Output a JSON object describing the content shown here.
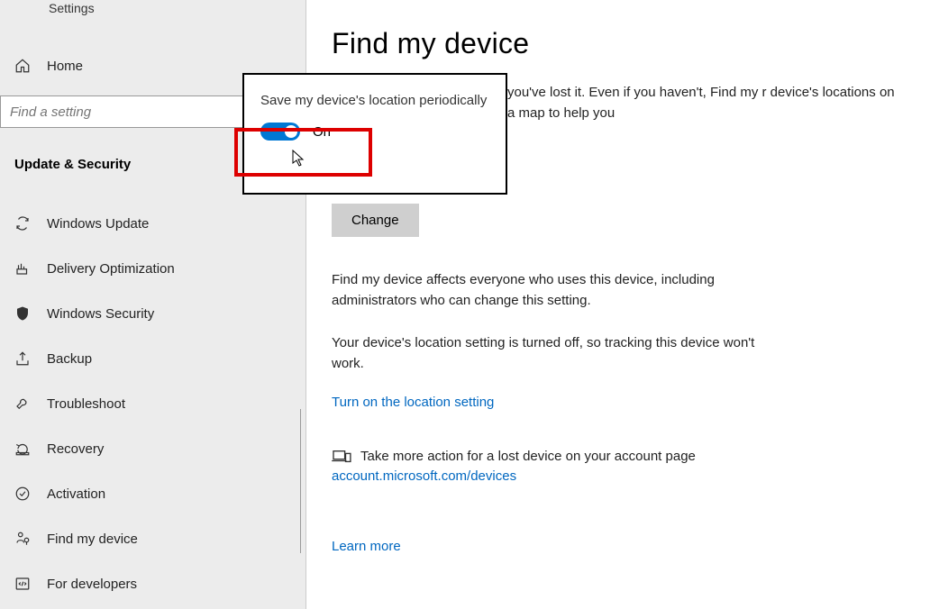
{
  "app_title": "Settings",
  "home_label": "Home",
  "search": {
    "placeholder": "Find a setting"
  },
  "section_label": "Update & Security",
  "sidebar": {
    "items": [
      {
        "label": "Windows Update",
        "icon": "sync-icon"
      },
      {
        "label": "Delivery Optimization",
        "icon": "delivery-icon"
      },
      {
        "label": "Windows Security",
        "icon": "shield-icon"
      },
      {
        "label": "Backup",
        "icon": "backup-icon"
      },
      {
        "label": "Troubleshoot",
        "icon": "wrench-icon"
      },
      {
        "label": "Recovery",
        "icon": "recovery-icon"
      },
      {
        "label": "Activation",
        "icon": "check-circle-icon"
      },
      {
        "label": "Find my device",
        "icon": "location-person-icon"
      },
      {
        "label": "For developers",
        "icon": "code-icon"
      }
    ]
  },
  "main": {
    "title": "Find my device",
    "desc_fragment": "you've lost it. Even if you haven't, Find my r device's locations on a map to help you",
    "change_btn": "Change",
    "para1": "Find my device affects everyone who uses this device, including administrators who can change this setting.",
    "para2": "Your device's location setting is turned off, so tracking this device won't work.",
    "turn_on_link": "Turn on the location setting",
    "action_text": "Take more action for a lost device on your account page",
    "action_link": "account.microsoft.com/devices",
    "learn_more": "Learn more"
  },
  "overlay": {
    "text": "Save my device's location periodically",
    "toggle_state": "On"
  }
}
